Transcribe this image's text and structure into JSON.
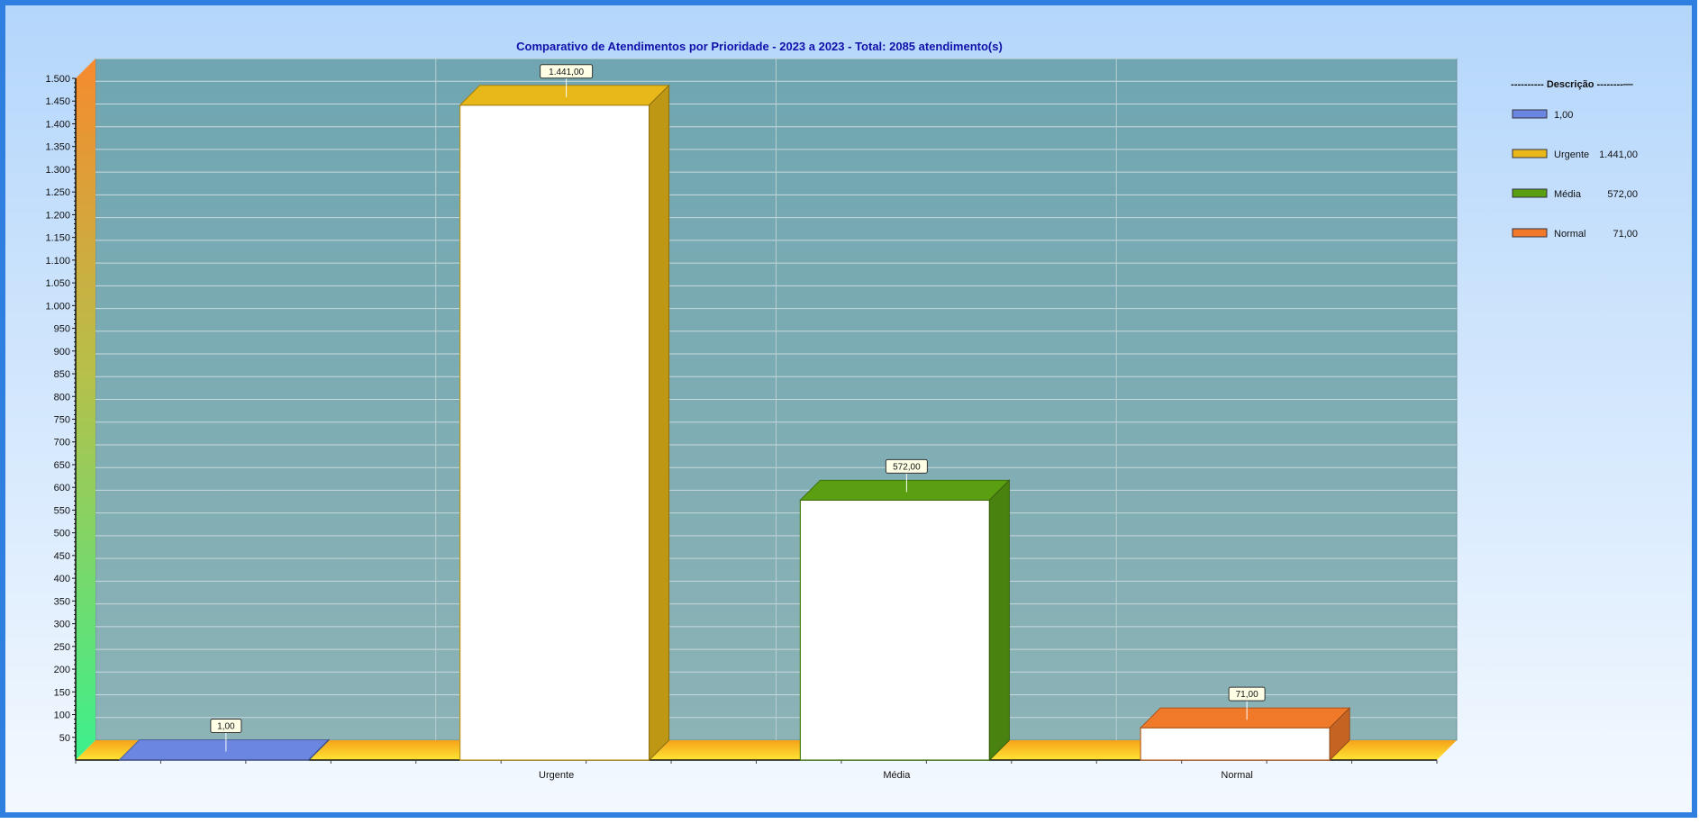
{
  "chart_data": {
    "type": "bar",
    "title": "Comparativo de Atendimentos por Prioridade - 2023 a 2023 - Total: 2085 atendimento(s)",
    "categories": [
      "",
      "Urgente",
      "Média",
      "Normal"
    ],
    "values": [
      1,
      1441,
      572,
      71
    ],
    "value_labels": [
      "1,00",
      "1.441,00",
      "572,00",
      "71,00"
    ],
    "series_colors": [
      "#6b86e0",
      "#e8b81a",
      "#5a9e12",
      "#f07a2a"
    ],
    "ylim": [
      0,
      1500
    ],
    "yticks": [
      50,
      100,
      150,
      200,
      250,
      300,
      350,
      400,
      450,
      500,
      550,
      600,
      650,
      700,
      750,
      800,
      850,
      900,
      950,
      1000,
      1050,
      1100,
      1150,
      1200,
      1250,
      1300,
      1350,
      1400,
      1450,
      1500
    ],
    "ytick_labels": [
      "50",
      "100",
      "150",
      "200",
      "250",
      "300",
      "350",
      "400",
      "450",
      "500",
      "550",
      "600",
      "650",
      "700",
      "750",
      "800",
      "850",
      "900",
      "950",
      "1.000",
      "1.050",
      "1.100",
      "1.150",
      "1.200",
      "1.250",
      "1.300",
      "1.350",
      "1.400",
      "1.450",
      "1.500"
    ],
    "grid": true,
    "legend_position": "right",
    "legend": {
      "title": "---------- Descrição --------—",
      "items": [
        {
          "label": "1,00",
          "value": "",
          "color": "#6b86e0"
        },
        {
          "label": "Urgente",
          "value": "1.441,00",
          "color": "#e8b81a"
        },
        {
          "label": "Média",
          "value": "572,00",
          "color": "#5a9e12"
        },
        {
          "label": "Normal",
          "value": "71,00",
          "color": "#f07a2a"
        }
      ]
    }
  }
}
